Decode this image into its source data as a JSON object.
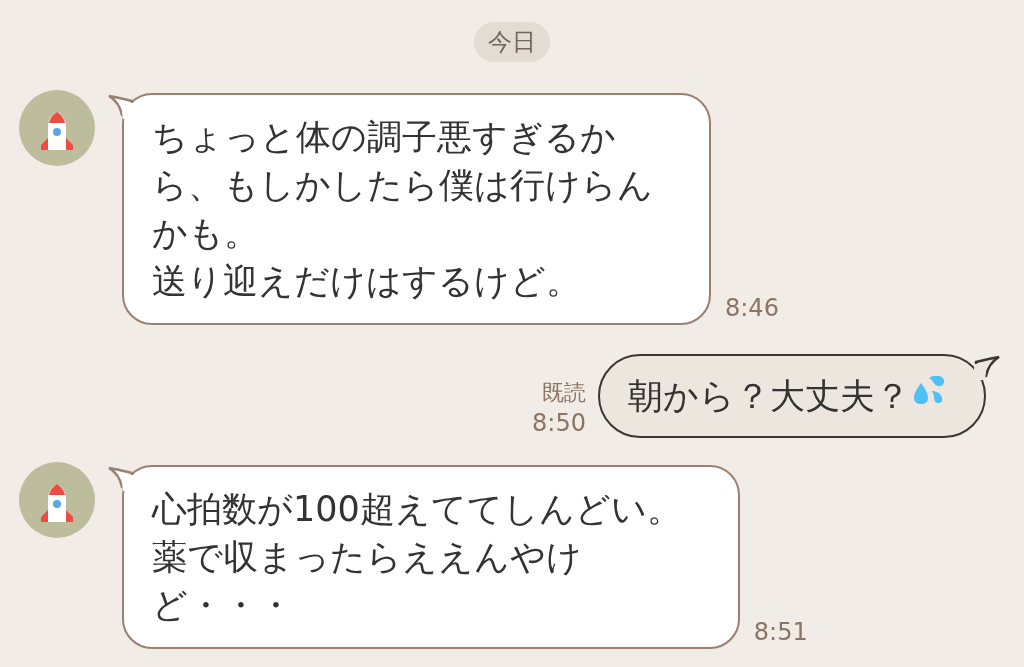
{
  "date_label": "今日",
  "messages": [
    {
      "kind": "received",
      "lines": [
        "ちょっと体の調子悪すぎるか",
        "ら、もしかしたら僕は行けらん",
        "かも。",
        "送り迎えだけはするけど。"
      ],
      "time": "8:46"
    },
    {
      "kind": "sent",
      "text": "朝から？大丈夫？",
      "trailing_icon": true,
      "read_label": "既読",
      "time": "8:50"
    },
    {
      "kind": "received",
      "lines": [
        "心拍数が100超えててしんどい。",
        "薬で収まったらええんやけ",
        "ど・・・"
      ],
      "time": "8:51"
    }
  ]
}
